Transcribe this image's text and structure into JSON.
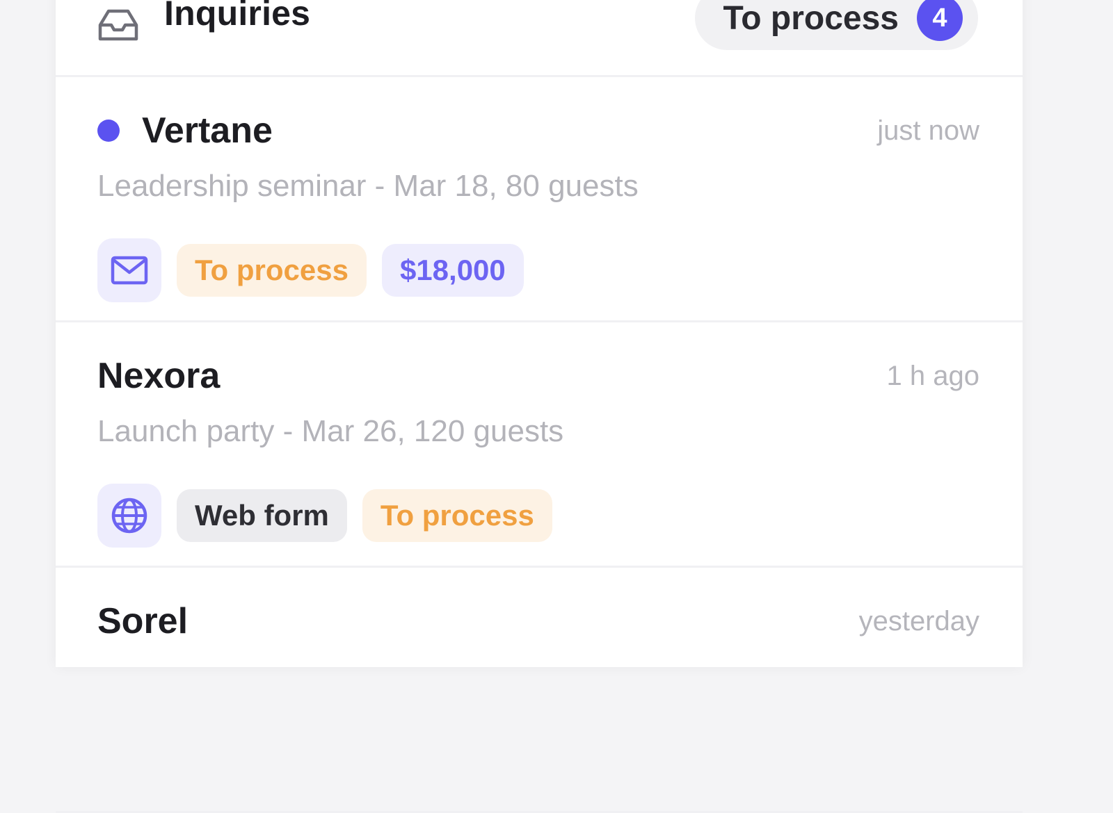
{
  "header": {
    "title": "Inquiries",
    "filter_label": "To process",
    "filter_count": "4"
  },
  "inquiries": [
    {
      "name": "Vertane",
      "time": "just now",
      "description": "Leadership seminar - Mar 18, 80 guests",
      "unread": true,
      "source_icon": "mail-icon",
      "status": "To process",
      "amount": "$18,000"
    },
    {
      "name": "Nexora",
      "time": "1 h ago",
      "description": "Launch party - Mar 26, 120 guests",
      "unread": false,
      "source_icon": "globe-icon",
      "source": "Web form",
      "status": "To process"
    },
    {
      "name": "Sorel",
      "time": "yesterday"
    }
  ],
  "colors": {
    "accent": "#5b52f0",
    "status_orange": "#f0a040",
    "muted_text": "#b3b3b9"
  }
}
